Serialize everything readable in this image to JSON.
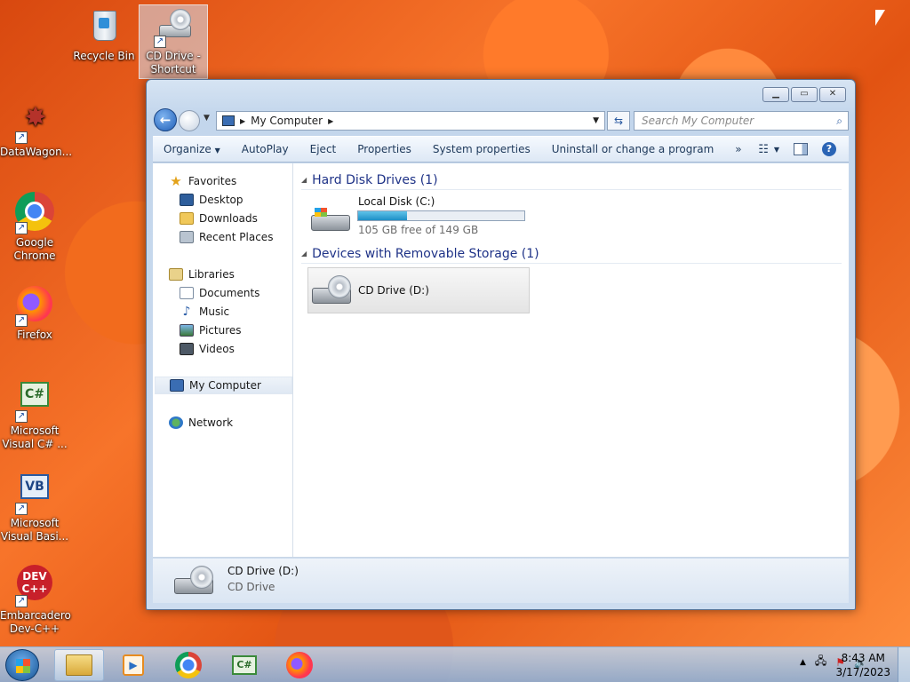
{
  "desktop": {
    "icons": [
      {
        "label": "Recycle Bin"
      },
      {
        "label": "CD Drive - Shortcut"
      },
      {
        "label": "DataWagon..."
      },
      {
        "label": "Google Chrome"
      },
      {
        "label": "Firefox"
      },
      {
        "label": "Microsoft Visual C# ..."
      },
      {
        "label": "Microsoft Visual Basi..."
      },
      {
        "label": "Embarcadero Dev-C++"
      }
    ]
  },
  "window": {
    "address": "My Computer",
    "search_placeholder": "Search My Computer",
    "toolbar": {
      "organize": "Organize",
      "autoplay": "AutoPlay",
      "eject": "Eject",
      "properties": "Properties",
      "system_properties": "System properties",
      "uninstall": "Uninstall or change a program",
      "more": "»",
      "help": "?"
    },
    "nav": {
      "favorites": "Favorites",
      "desktop": "Desktop",
      "downloads": "Downloads",
      "recent_places": "Recent Places",
      "libraries": "Libraries",
      "documents": "Documents",
      "music": "Music",
      "pictures": "Pictures",
      "videos": "Videos",
      "my_computer": "My Computer",
      "network": "Network"
    },
    "groups": {
      "hard_disk": "Hard Disk Drives (1)",
      "removable": "Devices with Removable Storage (1)"
    },
    "local_disk": {
      "name": "Local Disk (C:)",
      "free_text": "105 GB free of 149 GB",
      "used_fraction": 0.295
    },
    "cd_drive": {
      "name": "CD Drive (D:)"
    },
    "details": {
      "name": "CD Drive (D:)",
      "type": "CD Drive"
    }
  },
  "taskbar": {
    "time": "8:43 AM",
    "date": "3/17/2023"
  },
  "colors": {
    "accent": "#1e3287",
    "capacity_fill": "#1d8fc6"
  }
}
